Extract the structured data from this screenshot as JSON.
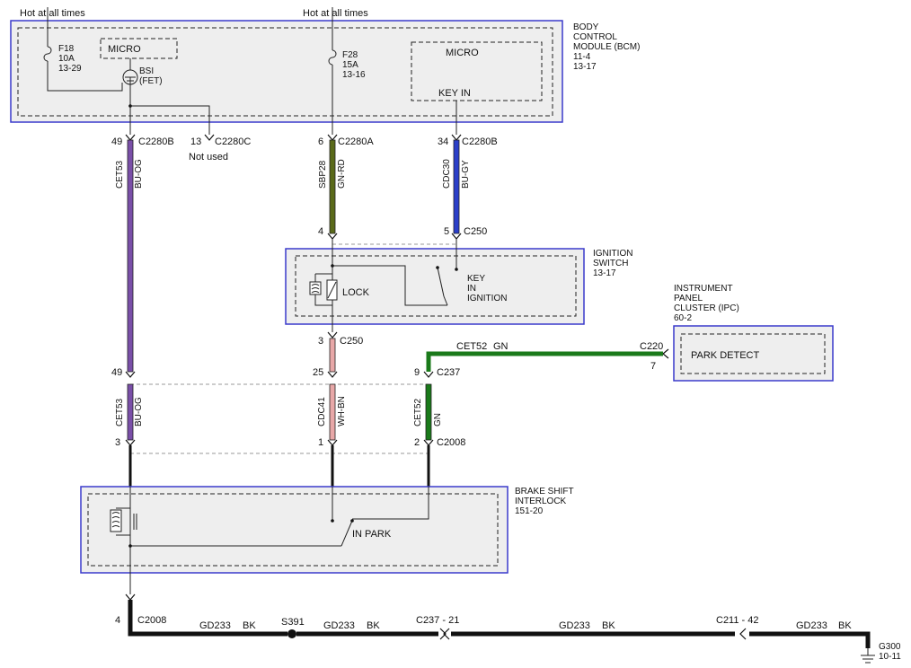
{
  "top_labels": {
    "hot_left": "Hot at all times",
    "hot_center": "Hot at all times"
  },
  "bcm": {
    "title": [
      "BODY",
      "CONTROL",
      "MODULE (BCM)",
      "11-4",
      "13-17"
    ],
    "f18": [
      "F18",
      "10A",
      "13-29"
    ],
    "f28": [
      "F28",
      "15A",
      "13-16"
    ],
    "micro_left": "MICRO",
    "micro_right": "MICRO",
    "key_in": "KEY IN",
    "bsi": [
      "BSI",
      "(FET)"
    ]
  },
  "connectors_top": {
    "c49": "49",
    "c2280b_left": "C2280B",
    "c13": "13",
    "c2280c": "C2280C",
    "not_used": "Not used",
    "c6": "6",
    "c2280a": "C2280A",
    "c34": "34",
    "c2280b_right": "C2280B"
  },
  "wires_top": {
    "cet53": "CET53",
    "bu_og": "BU-OG",
    "sbp28": "SBP28",
    "gn_rd": "GN-RD",
    "cdc30": "CDC30",
    "bu_gy": "BU-GY"
  },
  "ignition": {
    "title": [
      "IGNITION",
      "SWITCH",
      "13-17"
    ],
    "pin4": "4",
    "pin5": "5",
    "c250": "C250",
    "lock": "LOCK",
    "key": [
      "KEY",
      "IN",
      "IGNITION"
    ],
    "pin3": "3",
    "c250_b": "C250"
  },
  "ipc": {
    "title": [
      "INSTRUMENT",
      "PANEL",
      "CLUSTER (IPC)",
      "60-2"
    ],
    "park_detect": "PARK DETECT",
    "c220": "C220",
    "pin7": "7",
    "cet52": "CET52",
    "gn": "GN"
  },
  "c237": {
    "pin49": "49",
    "pin25": "25",
    "pin9": "9",
    "c237": "C237"
  },
  "wires_mid": {
    "cet53": "CET53",
    "bu_og": "BU-OG",
    "cdc41": "CDC41",
    "wh_bn": "WH-BN",
    "cet52": "CET52",
    "gn": "GN"
  },
  "c2008": {
    "pin3": "3",
    "pin1": "1",
    "pin2": "2",
    "c2008": "C2008"
  },
  "bsi_module": {
    "title": [
      "BRAKE SHIFT",
      "INTERLOCK",
      "151-20"
    ],
    "in_park": "IN PARK"
  },
  "ground": {
    "pin4": "4",
    "c2008": "C2008",
    "gd1": "GD233",
    "bk1": "BK",
    "s391": "S391",
    "gd2": "GD233",
    "bk2": "BK",
    "c237": "C237 -  21",
    "gd3": "GD233",
    "bk3": "BK",
    "c211": "C211 -  42",
    "gd4": "GD233",
    "bk4": "BK",
    "g300": [
      "G300",
      "10-11"
    ]
  },
  "colors": {
    "module_border": "#3a3acc",
    "wire_bu_og": "#7a4fa8",
    "wire_gn_rd": "#5a6a1a",
    "wire_bu_gy": "#2a3ec8",
    "wire_wh_bn": "#e8a8a8",
    "wire_gn": "#1a7a1a",
    "wire_bk": "#111111"
  }
}
